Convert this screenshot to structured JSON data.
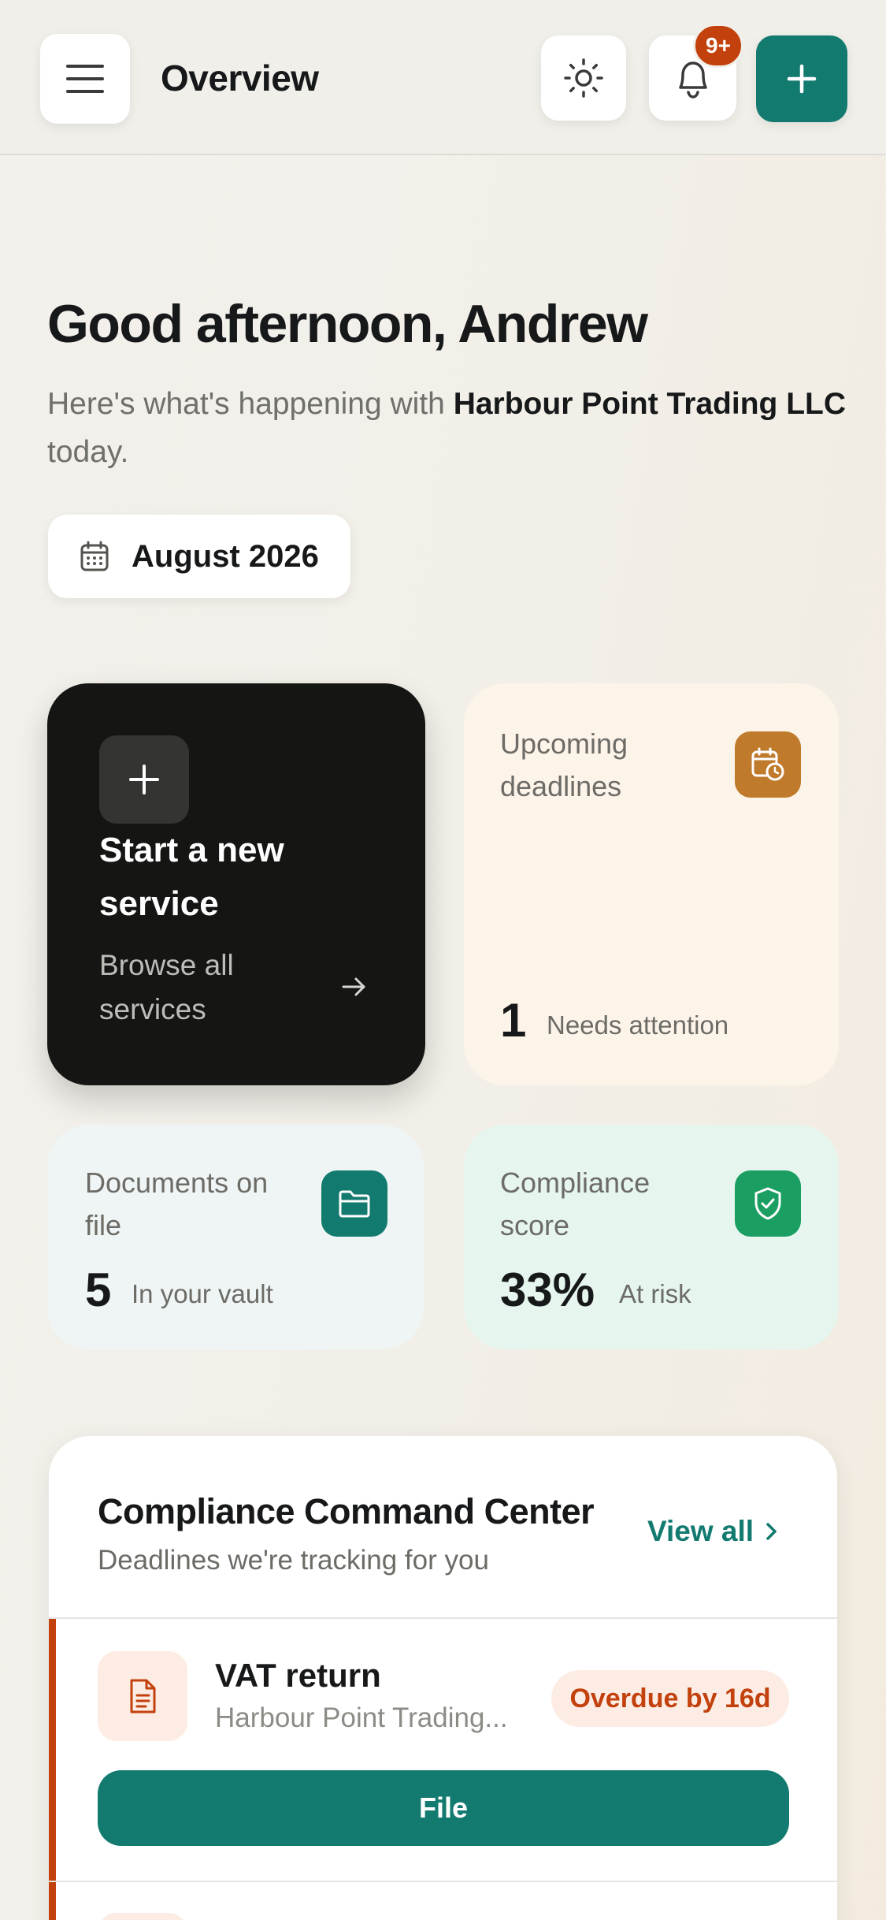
{
  "header": {
    "title": "Overview",
    "notification_badge": "9+",
    "icons": [
      "menu-icon",
      "sun-icon",
      "bell-icon",
      "plus-icon"
    ]
  },
  "greeting": {
    "headline": "Good afternoon, Andrew",
    "subtitle_prefix": "Here's what's happening with ",
    "company": "Harbour Point Trading LLC",
    "subtitle_suffix": " today."
  },
  "date_selector": {
    "label": "August 2026",
    "icon": "calendar-icon"
  },
  "cards": {
    "new_service": {
      "title": "Start a new service",
      "link": "Browse all services"
    },
    "deadlines": {
      "label": "Upcoming deadlines",
      "value": "1",
      "caption": "Needs attention",
      "color": "#c07a2c"
    },
    "documents": {
      "label": "Documents on file",
      "value": "5",
      "caption": "In your vault",
      "color": "#137a70"
    },
    "compliance": {
      "label": "Compliance score",
      "value": "33%",
      "caption": "At risk",
      "color": "#1b9e62"
    }
  },
  "compliance_center": {
    "title": "Compliance Command Center",
    "subtitle": "Deadlines we're tracking for you",
    "view_all": "View all",
    "items": [
      {
        "title": "VAT return",
        "company": "Harbour Point Trading...",
        "status": "Overdue by 16d",
        "action": "File"
      }
    ]
  },
  "colors": {
    "accent": "#137a70",
    "danger": "#c2410c",
    "dark_card": "#151613"
  }
}
